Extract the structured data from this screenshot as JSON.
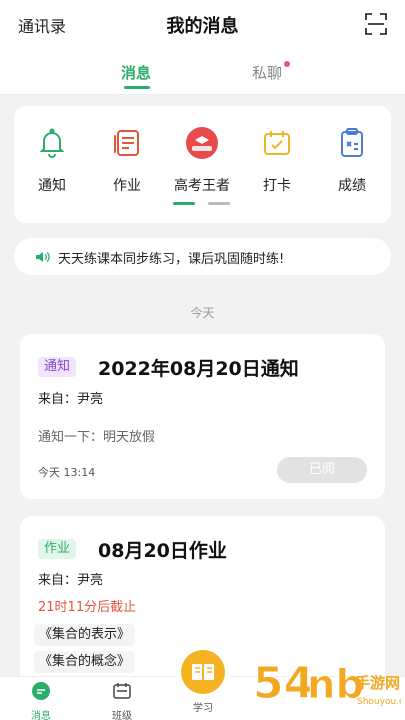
{
  "header": {
    "left_label": "通讯录",
    "title": "我的消息",
    "right_icon": "scan-icon"
  },
  "tabs": [
    {
      "label": "消息",
      "active": true
    },
    {
      "label": "私聊",
      "active": false,
      "has_dot": true
    }
  ],
  "menu": [
    {
      "label": "通知",
      "icon": "bell-icon",
      "color": "#2bae6b"
    },
    {
      "label": "作业",
      "icon": "homework-icon",
      "color": "#e0563f"
    },
    {
      "label": "高考王者",
      "icon": "exam-king-icon",
      "color": "#e84b4b"
    },
    {
      "label": "打卡",
      "icon": "checkin-icon",
      "color": "#f0b429"
    },
    {
      "label": "成绩",
      "icon": "grades-icon",
      "color": "#4a7bd6"
    }
  ],
  "notice": {
    "text": "天天练课本同步练习，课后巩固随时练!"
  },
  "day_label": "今天",
  "messages": [
    {
      "type": "通知",
      "title": "2022年08月20日通知",
      "from": "来自：尹亮",
      "body": "通知一下：明天放假",
      "time": "今天 13:14",
      "status": "已阅"
    },
    {
      "type": "作业",
      "title": "08月20日作业",
      "from": "来自：尹亮",
      "deadline": "21时11分后截止",
      "items": [
        "《集合的表示》",
        "《集合的概念》"
      ]
    }
  ],
  "bottom_nav": [
    {
      "label": "消息",
      "icon": "chat-icon",
      "active": true
    },
    {
      "label": "班级",
      "icon": "class-icon",
      "active": false
    },
    {
      "label": "学习",
      "icon": "book-icon",
      "active": false
    }
  ],
  "colors": {
    "accent": "#2bae6b",
    "warning": "#e0563f",
    "purple": "#8a43d6"
  },
  "watermark": {
    "text": "54nb手游网",
    "url": "Shouyou.com"
  }
}
